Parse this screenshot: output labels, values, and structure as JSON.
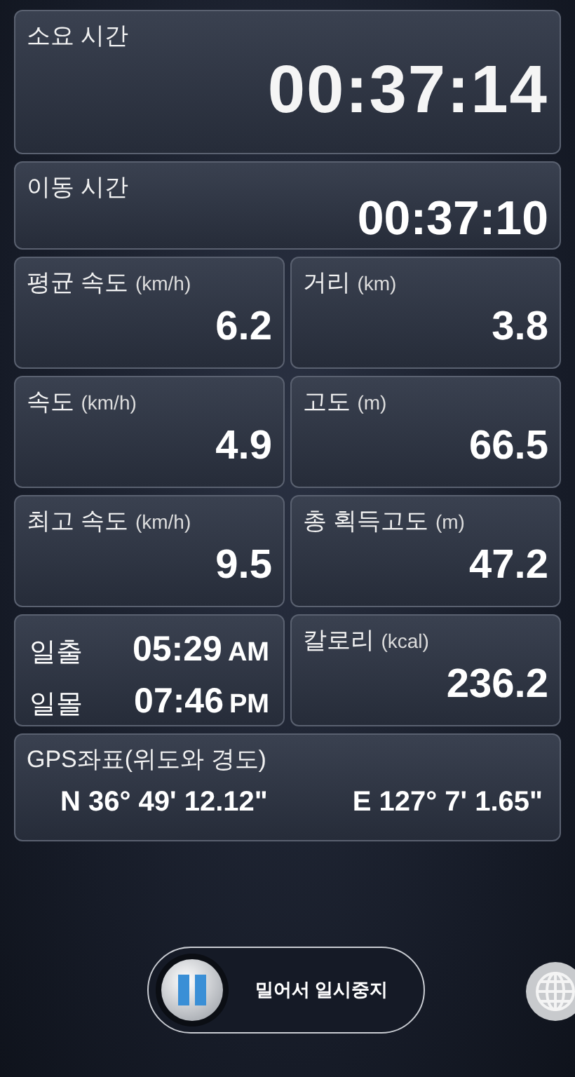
{
  "total_time": {
    "label": "소요 시간",
    "value": "00:37:14"
  },
  "moving_time": {
    "label": "이동 시간",
    "value": "00:37:10"
  },
  "cells": [
    {
      "kind": "metric",
      "label": "평균 속도",
      "unit": "(km/h)",
      "value": "6.2"
    },
    {
      "kind": "metric",
      "label": "거리",
      "unit": "(km)",
      "value": "3.8"
    },
    {
      "kind": "metric",
      "label": "속도",
      "unit": "(km/h)",
      "value": "4.9"
    },
    {
      "kind": "metric",
      "label": "고도",
      "unit": "(m)",
      "value": "66.5"
    },
    {
      "kind": "metric",
      "label": "최고 속도",
      "unit": "(km/h)",
      "value": "9.5"
    },
    {
      "kind": "metric",
      "label": "총 획득고도",
      "unit": "(m)",
      "value": "47.2"
    },
    {
      "kind": "sun",
      "rows": [
        {
          "label": "일출",
          "time": "05:29",
          "period": "AM"
        },
        {
          "label": "일몰",
          "time": "07:46",
          "period": "PM"
        }
      ]
    },
    {
      "kind": "metric",
      "label": "칼로리",
      "unit": "(kcal)",
      "value": "236.2"
    }
  ],
  "gps": {
    "label": "GPS좌표(위도와 경도)",
    "latitude": "N 36° 49' 12.12\"",
    "longitude": "E 127° 7' 1.65\""
  },
  "pause_slider": {
    "label": "밀어서 일시중지",
    "level": 0
  }
}
